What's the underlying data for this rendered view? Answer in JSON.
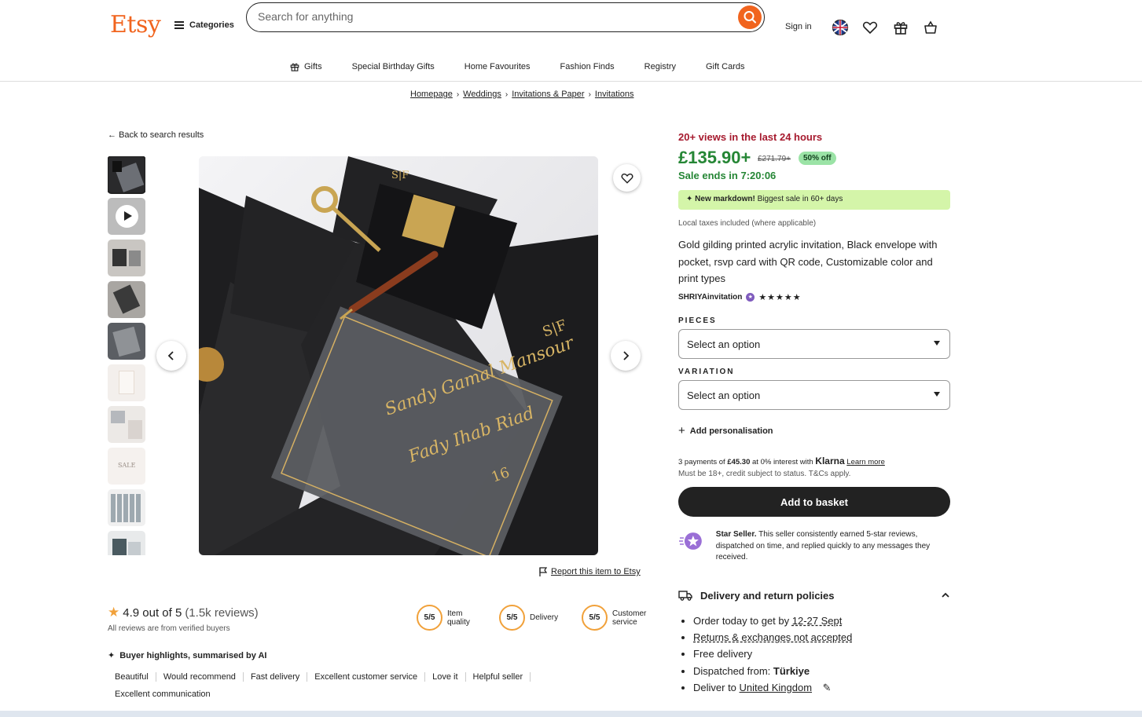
{
  "header": {
    "logo": "Etsy",
    "categories_label": "Categories",
    "search_placeholder": "Search for anything",
    "sign_in_label": "Sign in"
  },
  "subnav": [
    "Gifts",
    "Special Birthday Gifts",
    "Home Favourites",
    "Fashion Finds",
    "Registry",
    "Gift Cards"
  ],
  "breadcrumb": [
    "Homepage",
    "Weddings",
    "Invitations & Paper",
    "Invitations"
  ],
  "back_label": "Back to search results",
  "report_label": "Report this item to Etsy",
  "reviews": {
    "rating_text": "4.9 out of 5",
    "count_text": "(1.5k reviews)",
    "verified_text": "All reviews are from verified buyers",
    "scores": [
      {
        "value": "5/5",
        "label": "Item quality"
      },
      {
        "value": "5/5",
        "label": "Delivery"
      },
      {
        "value": "5/5",
        "label": "Customer service"
      }
    ],
    "highlights_title": "Buyer highlights, summarised by AI",
    "tags": [
      "Beautiful",
      "Would recommend",
      "Fast delivery",
      "Excellent customer service",
      "Love it",
      "Helpful seller",
      "Excellent communication"
    ]
  },
  "product": {
    "views_text": "20+ views in the last 24 hours",
    "price": "£135.90+",
    "original_price": "£271.79+",
    "discount": "50% off",
    "sale_ends": "Sale ends in 7:20:06",
    "markdown_bold": "New markdown!",
    "markdown_rest": " Biggest sale in 60+ days",
    "taxes": "Local taxes included (where applicable)",
    "title": "Gold gilding printed acrylic invitation, Black envelope with pocket, rsvp card with QR code, Customizable color and print types",
    "seller": "SHRIYAinvitation",
    "stars": "★★★★★",
    "pieces_label": "PIECES",
    "pieces_value": "Select an option",
    "variation_label": "VARIATION",
    "variation_value": "Select an option",
    "personalisation": "Add personalisation",
    "klarna_pre": "3 payments of ",
    "klarna_amount": "£45.30",
    "klarna_mid": " at 0% interest with ",
    "klarna_brand": "Klarna",
    "klarna_link": "Learn more",
    "klarna_note": "Must be 18+, credit subject to status. T&Cs apply.",
    "basket_label": "Add to basket",
    "star_seller_bold": "Star Seller.",
    "star_seller_text": " This seller consistently earned 5-star reviews, dispatched on time, and replied quickly to any messages they received."
  },
  "delivery": {
    "title": "Delivery and return policies",
    "order_pre": "Order today to get by ",
    "order_date": "12-27 Sept",
    "returns": "Returns & exchanges not accepted",
    "free": "Free delivery",
    "dispatched_pre": "Dispatched from: ",
    "dispatched_country": "Türkiye",
    "deliver_pre": "Deliver to ",
    "deliver_country": "United Kingdom"
  },
  "colors": {
    "brand": "#f1641e",
    "price_green": "#258635",
    "views_red": "#a61a2e",
    "markdown_bg": "#d4f5a9",
    "badge_bg": "#9be3a6"
  }
}
